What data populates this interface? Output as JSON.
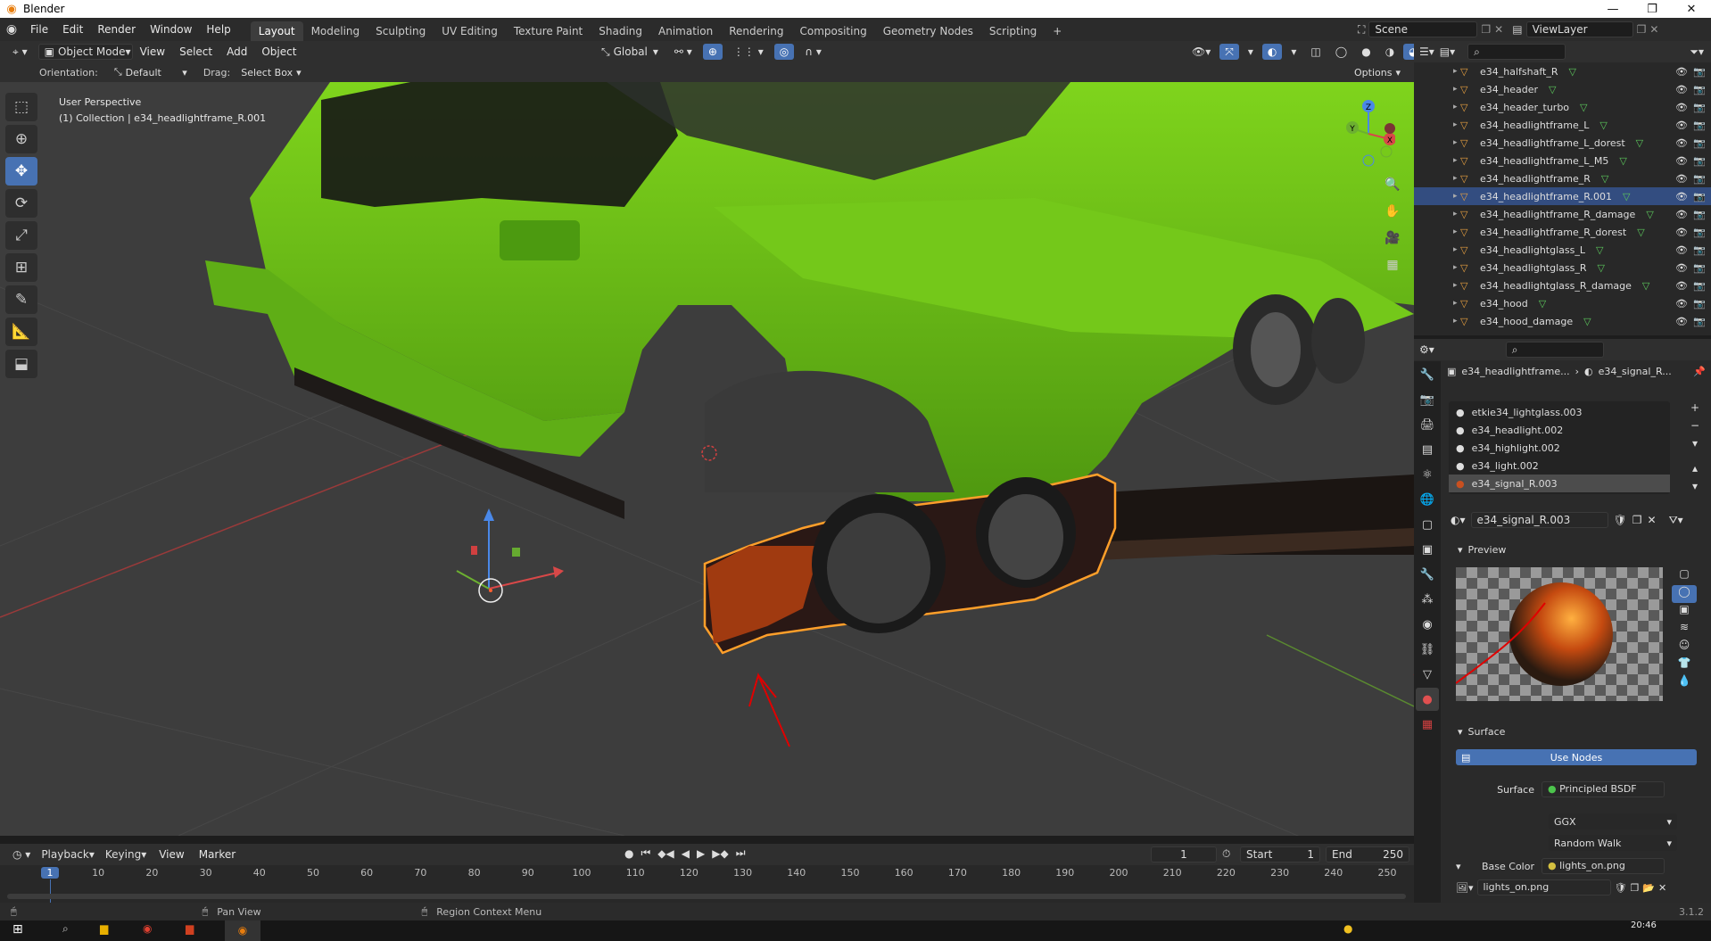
{
  "window": {
    "title": "Blender",
    "controls": [
      "—",
      "❐",
      "✕"
    ]
  },
  "menus": [
    "File",
    "Edit",
    "Render",
    "Window",
    "Help"
  ],
  "workspaces": [
    "Layout",
    "Modeling",
    "Sculpting",
    "UV Editing",
    "Texture Paint",
    "Shading",
    "Animation",
    "Rendering",
    "Compositing",
    "Geometry Nodes",
    "Scripting"
  ],
  "active_workspace": "Layout",
  "scene": "Scene",
  "view_layer": "ViewLayer",
  "viewport_header": {
    "mode": "Object Mode",
    "menus": [
      "View",
      "Select",
      "Add",
      "Object"
    ],
    "transform": "Global"
  },
  "tool_settings": {
    "orientation_label": "Orientation:",
    "orientation_value": "Default",
    "drag_label": "Drag:",
    "drag_value": "Select Box",
    "options": "Options"
  },
  "viewport": {
    "view_name": "User Perspective",
    "collection_info": "(1) Collection | e34_headlightframe_R.001",
    "gizmo_axes": [
      "X",
      "Y",
      "Z"
    ],
    "body_color": "#6bc016",
    "selection_color": "#ff9f2a",
    "annotation_color": "#e00000"
  },
  "outliner": {
    "items": [
      "e34_halfshaft_R",
      "e34_header",
      "e34_header_turbo",
      "e34_headlightframe_L",
      "e34_headlightframe_L_dorest",
      "e34_headlightframe_L_M5",
      "e34_headlightframe_R",
      "e34_headlightframe_R.001",
      "e34_headlightframe_R_damage",
      "e34_headlightframe_R_dorest",
      "e34_headlightglass_L",
      "e34_headlightglass_R",
      "e34_headlightglass_R_damage",
      "e34_hood",
      "e34_hood_damage"
    ],
    "selected": "e34_headlightframe_R.001"
  },
  "properties": {
    "breadcrumb_object": "e34_headlightframe...",
    "breadcrumb_material": "e34_signal_R...",
    "material_slots": [
      "etkie34_lightglass.003",
      "e34_headlight.002",
      "e34_highlight.002",
      "e34_light.002",
      "e34_signal_R.003"
    ],
    "selected_slot": "e34_signal_R.003",
    "material_name": "e34_signal_R.003",
    "preview_label": "Preview",
    "surface_section": "Surface",
    "use_nodes": "Use Nodes",
    "surface_label": "Surface",
    "surface_value": "Principled BSDF",
    "distribution": "GGX",
    "subsurface_method": "Random Walk",
    "base_color_label": "Base Color",
    "base_color_value": "lights_on.png",
    "image_name": "lights_on.png"
  },
  "timeline": {
    "menus": [
      "Playback",
      "Keying",
      "View",
      "Marker"
    ],
    "current_frame": "1",
    "start_label": "Start",
    "start_value": "1",
    "end_label": "End",
    "end_value": "250",
    "ticks": [
      "1",
      "10",
      "20",
      "30",
      "40",
      "50",
      "60",
      "70",
      "80",
      "90",
      "100",
      "110",
      "120",
      "130",
      "140",
      "150",
      "160",
      "170",
      "180",
      "190",
      "200",
      "210",
      "220",
      "230",
      "240",
      "250"
    ]
  },
  "status": {
    "pan_view": "Pan View",
    "region_context_menu": "Region Context Menu",
    "version": "3.1.2"
  },
  "taskbar": {
    "clock": "20:46"
  }
}
